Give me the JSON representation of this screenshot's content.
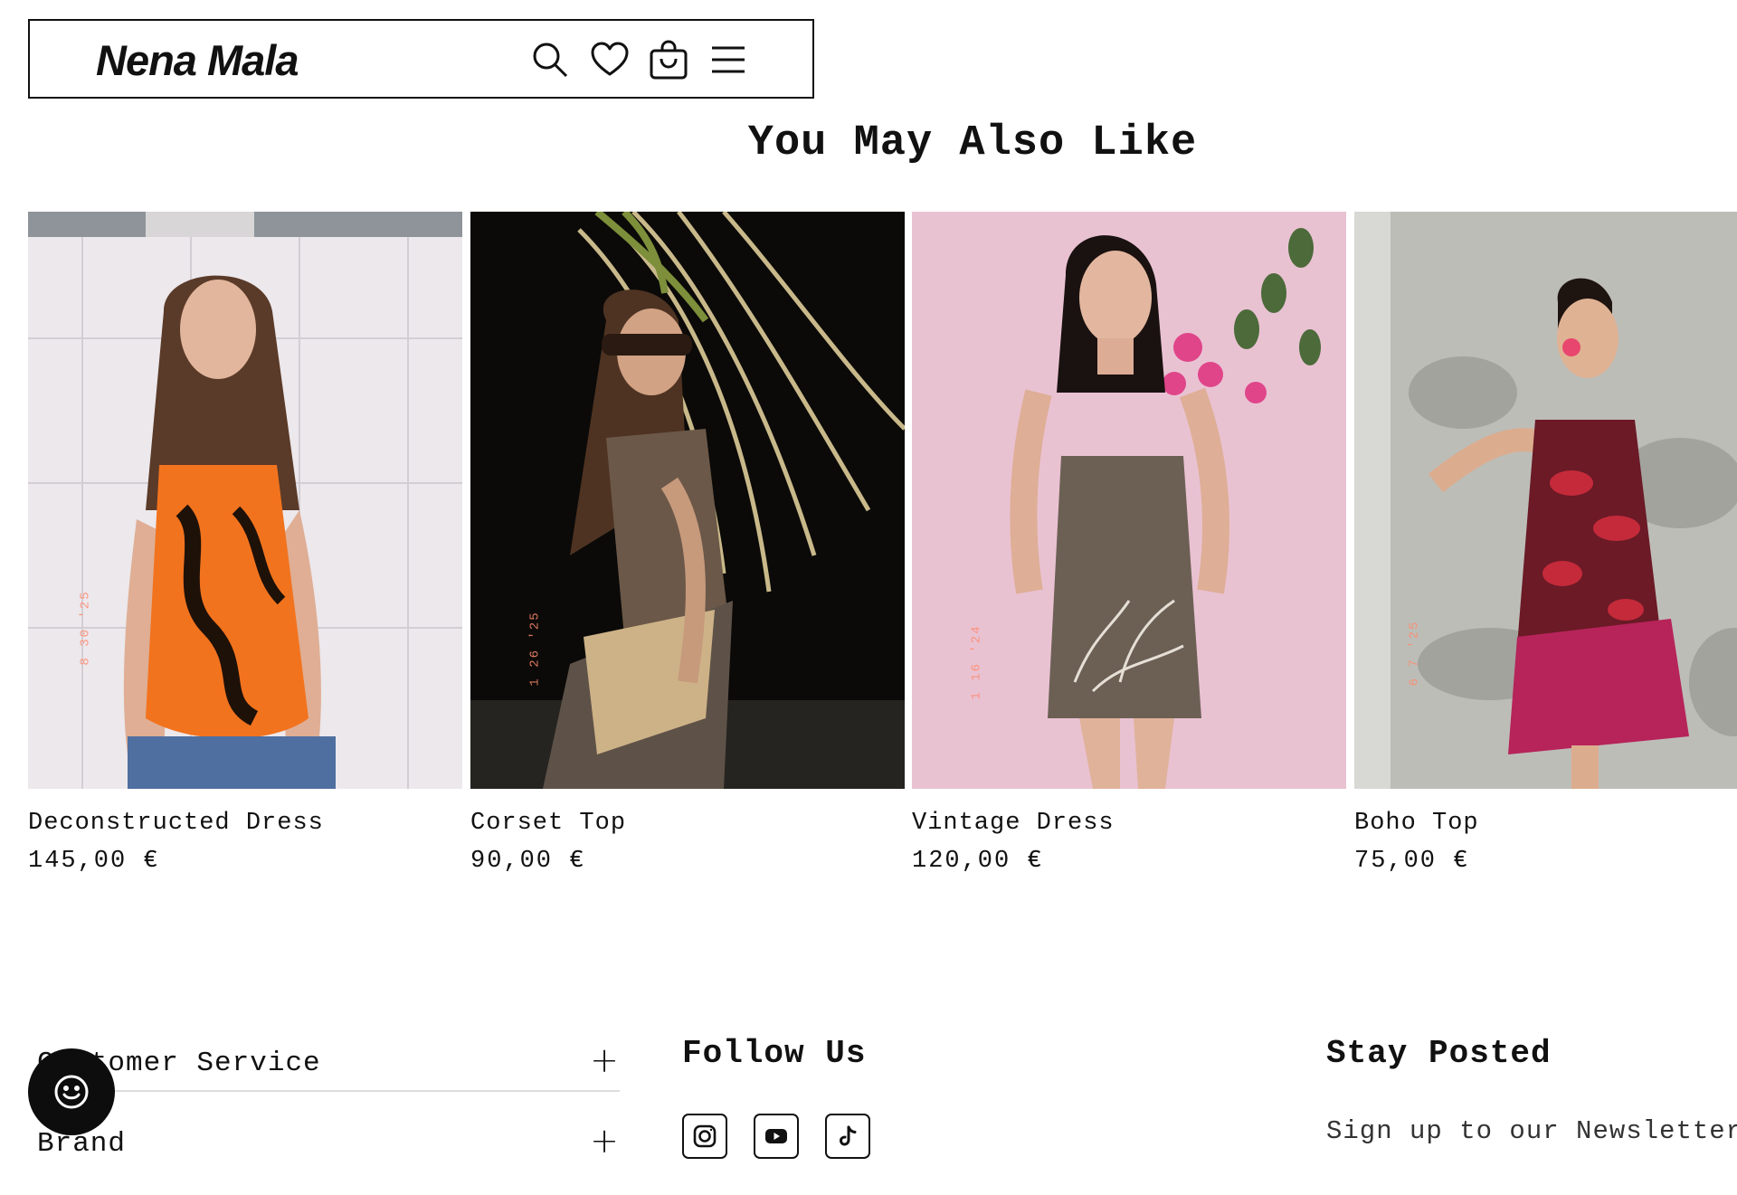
{
  "header": {
    "logo": "Nena Mala",
    "icons": [
      "search-icon",
      "heart-icon",
      "shopping-bag-icon",
      "menu-icon"
    ]
  },
  "section": {
    "title": "You May Also Like"
  },
  "products": [
    {
      "name": "Deconstructed Dress",
      "price": "145,00 €",
      "photo_stamp": "8 30 '25"
    },
    {
      "name": "Corset Top",
      "price": "90,00 €",
      "photo_stamp": "1 26 '25"
    },
    {
      "name": "Vintage Dress",
      "price": "120,00 €",
      "photo_stamp": "1 16 '24"
    },
    {
      "name": "Boho Top",
      "price": "75,00 €",
      "photo_stamp": "6 7 '25"
    }
  ],
  "footer": {
    "accordion": [
      {
        "label": "Customer Service",
        "toggle": "+"
      },
      {
        "label": "Brand",
        "toggle": "+"
      }
    ],
    "follow_heading": "Follow Us",
    "social_icons": [
      "instagram-icon",
      "youtube-icon",
      "tiktok-icon"
    ],
    "stay_heading": "Stay Posted",
    "newsletter_text": "Sign up to our Newsletter"
  },
  "colors": {
    "text": "#111111",
    "background": "#ffffff",
    "chat_button": "#0d0d0d",
    "stamp": "#ff8a6e"
  }
}
